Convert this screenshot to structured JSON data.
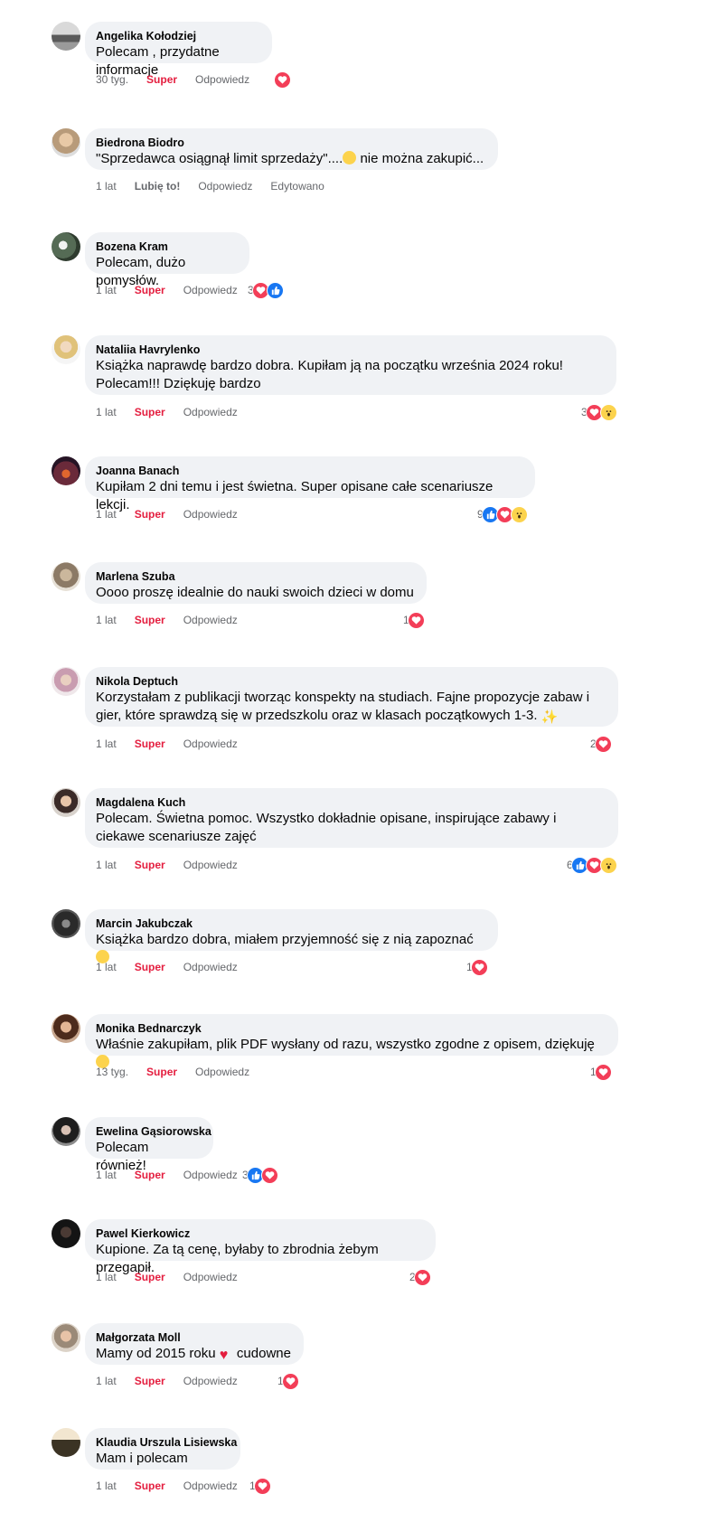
{
  "labels": {
    "super": "Super",
    "reply": "Odpowiedz",
    "like": "Lubię to!",
    "edited": "Edytowano"
  },
  "comments": [
    {
      "author": "Angelika Kołodziej",
      "text": "Polecam , przydatne informacje",
      "time": "30 tyg.",
      "reaction_label": "Super",
      "reactions": {
        "count": "",
        "types": [
          "heart"
        ]
      }
    },
    {
      "author": "Biedrona Biodro",
      "text_before": "\"Sprzedawca osiągnął limit sprzedaży\"....",
      "text_after": " nie można zakupić...",
      "time": "1 lat",
      "reaction_label": "Lubię to!",
      "edited": "Edytowano",
      "reactions": null
    },
    {
      "author": "Bozena Kram",
      "text": "Polecam, dużo pomysłów.",
      "time": "1 lat",
      "reaction_label": "Super",
      "reactions": {
        "count": "3",
        "types": [
          "heart",
          "like"
        ]
      }
    },
    {
      "author": "Nataliia Havrylenko",
      "text": "Książka naprawdę bardzo dobra. Kupiłam ją na początku września 2024 roku! Polecam!!! Dziękuję bardzo",
      "time": "1 lat",
      "reaction_label": "Super",
      "reactions": {
        "count": "3",
        "types": [
          "heart",
          "wow"
        ]
      }
    },
    {
      "author": "Joanna Banach",
      "text": "Kupiłam 2 dni temu i jest świetna. Super opisane całe scenariusze lekcji.",
      "time": "1 lat",
      "reaction_label": "Super",
      "reactions": {
        "count": "9",
        "types": [
          "like",
          "heart",
          "wow"
        ]
      }
    },
    {
      "author": "Marlena Szuba",
      "text": "Oooo proszę idealnie do nauki swoich dzieci w domu",
      "time": "1 lat",
      "reaction_label": "Super",
      "reactions": {
        "count": "1",
        "types": [
          "heart"
        ]
      }
    },
    {
      "author": "Nikola Deptuch",
      "text": "Korzystałam z publikacji tworząc konspekty na studiach. Fajne propozycje zabaw i gier, które sprawdzą się w przedszkolu oraz w klasach początkowych 1-3.",
      "time": "1 lat",
      "reaction_label": "Super",
      "reactions": {
        "count": "2",
        "types": [
          "heart"
        ]
      }
    },
    {
      "author": "Magdalena Kuch",
      "text": "Polecam. Świetna pomoc. Wszystko dokładnie opisane, inspirujące zabawy i ciekawe scenariusze zajęć",
      "time": "1 lat",
      "reaction_label": "Super",
      "reactions": {
        "count": "6",
        "types": [
          "like",
          "heart",
          "wow"
        ]
      }
    },
    {
      "author": "Marcin Jakubczak",
      "text": "Książka bardzo dobra, miałem przyjemność się z nią zapoznać",
      "time": "1 lat",
      "reaction_label": "Super",
      "reactions": {
        "count": "1",
        "types": [
          "heart"
        ]
      }
    },
    {
      "author": "Monika Bednarczyk",
      "text": "Właśnie zakupiłam, plik PDF wysłany od razu, wszystko zgodne z opisem, dziękuję",
      "time": "13 tyg.",
      "reaction_label": "Super",
      "reactions": {
        "count": "1",
        "types": [
          "heart"
        ]
      }
    },
    {
      "author": "Ewelina Gąsiorowska",
      "text": "Polecam również!",
      "time": "1 lat",
      "reaction_label": "Super",
      "reactions": {
        "count": "3",
        "types": [
          "like",
          "heart"
        ]
      }
    },
    {
      "author": "Pawel Kierkowicz",
      "text": "Kupione. Za tą cenę, byłaby to zbrodnia żebym przegapił.",
      "time": "1 lat",
      "reaction_label": "Super",
      "reactions": {
        "count": "2",
        "types": [
          "heart"
        ]
      }
    },
    {
      "author": "Małgorzata Moll",
      "text_before": "Mamy od 2015 roku ",
      "text_after": " cudowne",
      "time": "1 lat",
      "reaction_label": "Super",
      "reactions": {
        "count": "1",
        "types": [
          "heart"
        ]
      }
    },
    {
      "author": "Klaudia Urszula Lisiewska",
      "text": "Mam i polecam",
      "time": "1 lat",
      "reaction_label": "Super",
      "reactions": {
        "count": "1",
        "types": [
          "heart"
        ]
      }
    }
  ],
  "colors": {
    "bubble": "#f0f2f5",
    "super": "#e41e3f",
    "meta": "#65676b",
    "heart": "#f33e58",
    "like": "#1877f2",
    "wow": "#fcd34d"
  }
}
